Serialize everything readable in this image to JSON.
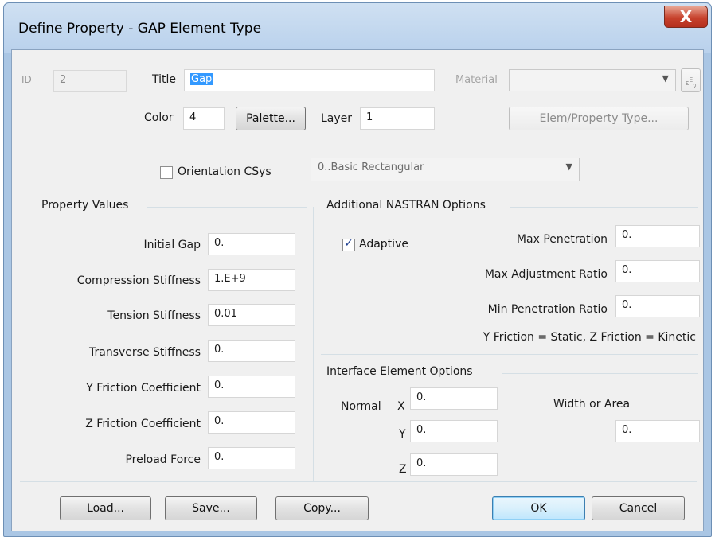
{
  "window": {
    "title": "Define Property - GAP Element Type",
    "close_glyph": "X"
  },
  "header": {
    "id_label": "ID",
    "id_value": "2",
    "title_label": "Title",
    "title_value": "Gap",
    "material_label": "Material",
    "material_value": "",
    "color_label": "Color",
    "color_value": "4",
    "palette_button": "Palette...",
    "layer_label": "Layer",
    "layer_value": "1",
    "elem_property_type_button": "Elem/Property Type...",
    "orientation_label": "Orientation CSys",
    "orientation_checked": false,
    "orientation_value": "0..Basic Rectangular"
  },
  "property_values": {
    "heading": "Property Values",
    "fields": [
      {
        "label": "Initial Gap",
        "value": "0."
      },
      {
        "label": "Compression Stiffness",
        "value": "1.E+9"
      },
      {
        "label": "Tension Stiffness",
        "value": "0.01"
      },
      {
        "label": "Transverse Stiffness",
        "value": "0."
      },
      {
        "label": "Y Friction Coefficient",
        "value": "0."
      },
      {
        "label": "Z Friction Coefficient",
        "value": "0."
      },
      {
        "label": "Preload Force",
        "value": "0."
      }
    ]
  },
  "nastran": {
    "heading": "Additional NASTRAN Options",
    "adaptive_label": "Adaptive",
    "adaptive_checked": true,
    "max_penetration_label": "Max Penetration",
    "max_penetration_value": "0.",
    "max_adjustment_label": "Max Adjustment Ratio",
    "max_adjustment_value": "0.",
    "min_penetration_label": "Min Penetration Ratio",
    "min_penetration_value": "0.",
    "friction_note": "Y Friction = Static, Z Friction = Kinetic"
  },
  "interface": {
    "heading": "Interface Element Options",
    "normal_label": "Normal",
    "x_label": "X",
    "x_value": "0.",
    "y_label": "Y",
    "y_value": "0.",
    "z_label": "Z",
    "z_value": "0.",
    "width_label": "Width or Area",
    "width_value": "0."
  },
  "footer": {
    "load": "Load...",
    "save": "Save...",
    "copy": "Copy...",
    "ok": "OK",
    "cancel": "Cancel"
  },
  "icons": {
    "material_picker": "material-editor-icon",
    "dropdown": "chevron-down-icon",
    "check": "checkmark-icon"
  }
}
